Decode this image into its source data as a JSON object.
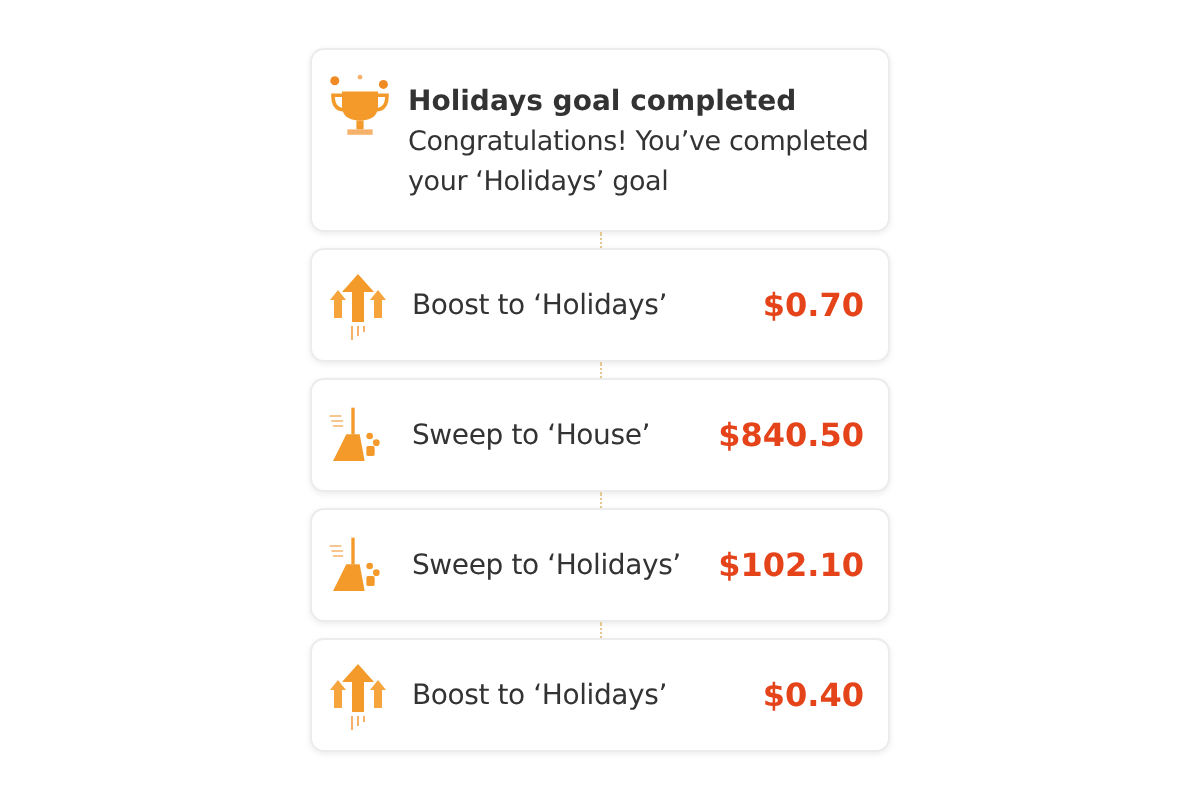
{
  "notice": {
    "title": "Holidays goal completed",
    "message": "Congratulations! You’ve completed your ‘Holidays’ goal"
  },
  "transactions": [
    {
      "kind": "boost",
      "label": "Boost to ‘Holidays’",
      "amount": "$0.70"
    },
    {
      "kind": "sweep",
      "label": "Sweep to ‘House’",
      "amount": "$840.50"
    },
    {
      "kind": "sweep",
      "label": "Sweep to ‘Holidays’",
      "amount": "$102.10"
    },
    {
      "kind": "boost",
      "label": "Boost to ‘Holidays’",
      "amount": "$0.40"
    }
  ]
}
